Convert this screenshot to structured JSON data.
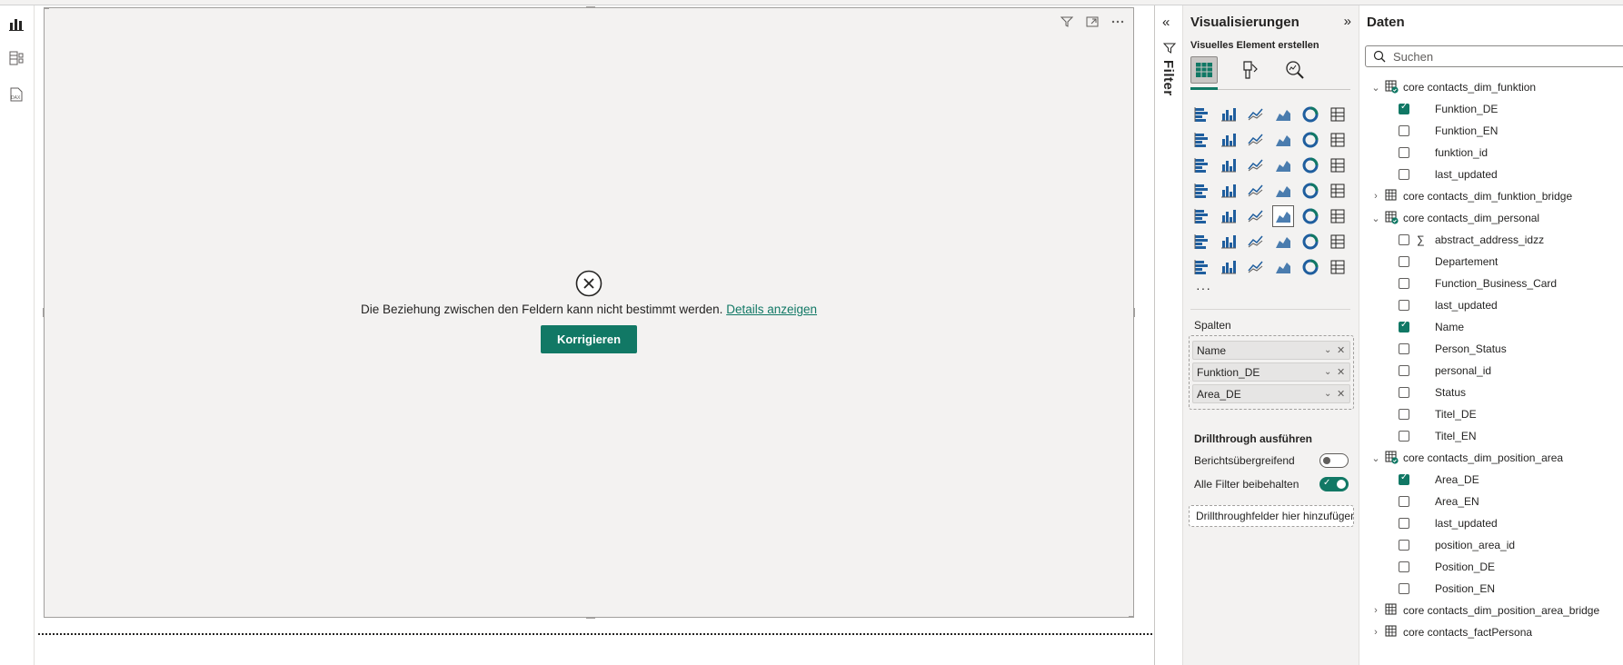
{
  "colors": {
    "accent": "#117865",
    "canvas_bg": "#f3f2f1",
    "pane_bg": "#f3f2f1"
  },
  "rail": [
    {
      "name": "report-view-icon"
    },
    {
      "name": "table-view-icon"
    },
    {
      "name": "dax-query-view-icon",
      "label": "DAX"
    }
  ],
  "visual": {
    "error_message": "Die Beziehung zwischen den Feldern kann nicht bestimmt werden.",
    "details_link": "Details anzeigen",
    "fix_button": "Korrigieren"
  },
  "filter_pane": {
    "label": "Filter"
  },
  "viz_pane": {
    "title": "Visualisierungen",
    "subtitle": "Visuelles Element erstellen",
    "more": "···",
    "wells_label": "Spalten",
    "wells": [
      {
        "label": "Name"
      },
      {
        "label": "Funktion_DE"
      },
      {
        "label": "Area_DE"
      }
    ],
    "drill": {
      "title": "Drillthrough ausführen",
      "cross_report_label": "Berichtsübergreifend",
      "cross_report_on": false,
      "keep_filters_label": "Alle Filter beibehalten",
      "keep_filters_on": true,
      "drop_placeholder": "Drillthroughfelder hier hinzufügen"
    }
  },
  "data_pane": {
    "title": "Daten",
    "search_placeholder": "Suchen",
    "tables": [
      {
        "name": "core contacts_dim_funktion",
        "expanded": true,
        "has_checked": true,
        "fields": [
          {
            "name": "Funktion_DE",
            "checked": true,
            "sigma": false
          },
          {
            "name": "Funktion_EN",
            "checked": false,
            "sigma": false
          },
          {
            "name": "funktion_id",
            "checked": false,
            "sigma": false
          },
          {
            "name": "last_updated",
            "checked": false,
            "sigma": false
          }
        ]
      },
      {
        "name": "core contacts_dim_funktion_bridge",
        "expanded": false,
        "has_checked": false,
        "fields": []
      },
      {
        "name": "core contacts_dim_personal",
        "expanded": true,
        "has_checked": true,
        "fields": [
          {
            "name": "abstract_address_idzz",
            "checked": false,
            "sigma": true
          },
          {
            "name": "Departement",
            "checked": false,
            "sigma": false
          },
          {
            "name": "Function_Business_Card",
            "checked": false,
            "sigma": false
          },
          {
            "name": "last_updated",
            "checked": false,
            "sigma": false
          },
          {
            "name": "Name",
            "checked": true,
            "sigma": false
          },
          {
            "name": "Person_Status",
            "checked": false,
            "sigma": false
          },
          {
            "name": "personal_id",
            "checked": false,
            "sigma": false
          },
          {
            "name": "Status",
            "checked": false,
            "sigma": false
          },
          {
            "name": "Titel_DE",
            "checked": false,
            "sigma": false
          },
          {
            "name": "Titel_EN",
            "checked": false,
            "sigma": false
          }
        ]
      },
      {
        "name": "core contacts_dim_position_area",
        "expanded": true,
        "has_checked": true,
        "fields": [
          {
            "name": "Area_DE",
            "checked": true,
            "sigma": false
          },
          {
            "name": "Area_EN",
            "checked": false,
            "sigma": false
          },
          {
            "name": "last_updated",
            "checked": false,
            "sigma": false
          },
          {
            "name": "position_area_id",
            "checked": false,
            "sigma": false
          },
          {
            "name": "Position_DE",
            "checked": false,
            "sigma": false
          },
          {
            "name": "Position_EN",
            "checked": false,
            "sigma": false
          }
        ]
      },
      {
        "name": "core contacts_dim_position_area_bridge",
        "expanded": false,
        "has_checked": false,
        "fields": []
      },
      {
        "name": "core contacts_factPersona",
        "expanded": false,
        "has_checked": false,
        "fields": []
      }
    ]
  }
}
